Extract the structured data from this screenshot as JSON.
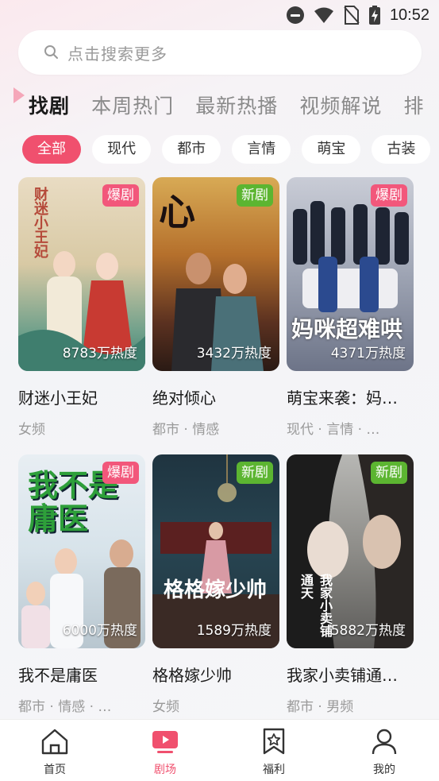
{
  "status_bar": {
    "time": "10:52"
  },
  "search": {
    "placeholder": "点击搜索更多"
  },
  "tabs": [
    {
      "label": "找剧",
      "active": true
    },
    {
      "label": "本周热门"
    },
    {
      "label": "最新热播"
    },
    {
      "label": "视频解说"
    },
    {
      "label": "排"
    }
  ],
  "chips": [
    {
      "label": "全部",
      "active": true
    },
    {
      "label": "现代"
    },
    {
      "label": "都市"
    },
    {
      "label": "言情"
    },
    {
      "label": "萌宝"
    },
    {
      "label": "古装"
    }
  ],
  "cards": [
    {
      "badge": "爆剧",
      "heat": "8783万热度",
      "title": "财迷小王妃",
      "tags": "女频",
      "poster_text": "财迷小王妃"
    },
    {
      "badge": "新剧",
      "heat": "3432万热度",
      "title": "绝对倾心",
      "tags": "都市 · 情感",
      "poster_text": "心"
    },
    {
      "badge": "爆剧",
      "heat": "4371万热度",
      "title": "萌宝来袭：妈…",
      "tags": "现代 · 言情 · …",
      "poster_text": "妈咪超难哄"
    },
    {
      "badge": "爆剧",
      "heat": "6000万热度",
      "title": "我不是庸医",
      "tags": "都市 · 情感 · …",
      "poster_text": "我不是庸医"
    },
    {
      "badge": "新剧",
      "heat": "1589万热度",
      "title": "格格嫁少帅",
      "tags": "女频",
      "poster_text": "格格嫁少帅"
    },
    {
      "badge": "新剧",
      "heat": "5882万热度",
      "title": "我家小卖铺通…",
      "tags": "都市 · 男频",
      "poster_text": "我家小卖铺通天"
    }
  ],
  "bottom_nav": [
    {
      "label": "首页",
      "icon": "home-icon"
    },
    {
      "label": "剧场",
      "icon": "theater-icon",
      "active": true
    },
    {
      "label": "福利",
      "icon": "bookmark-star-icon"
    },
    {
      "label": "我的",
      "icon": "user-icon"
    }
  ],
  "colors": {
    "accent": "#f0506e",
    "badge_hot": "#f2577b",
    "badge_new": "#5cb531"
  }
}
